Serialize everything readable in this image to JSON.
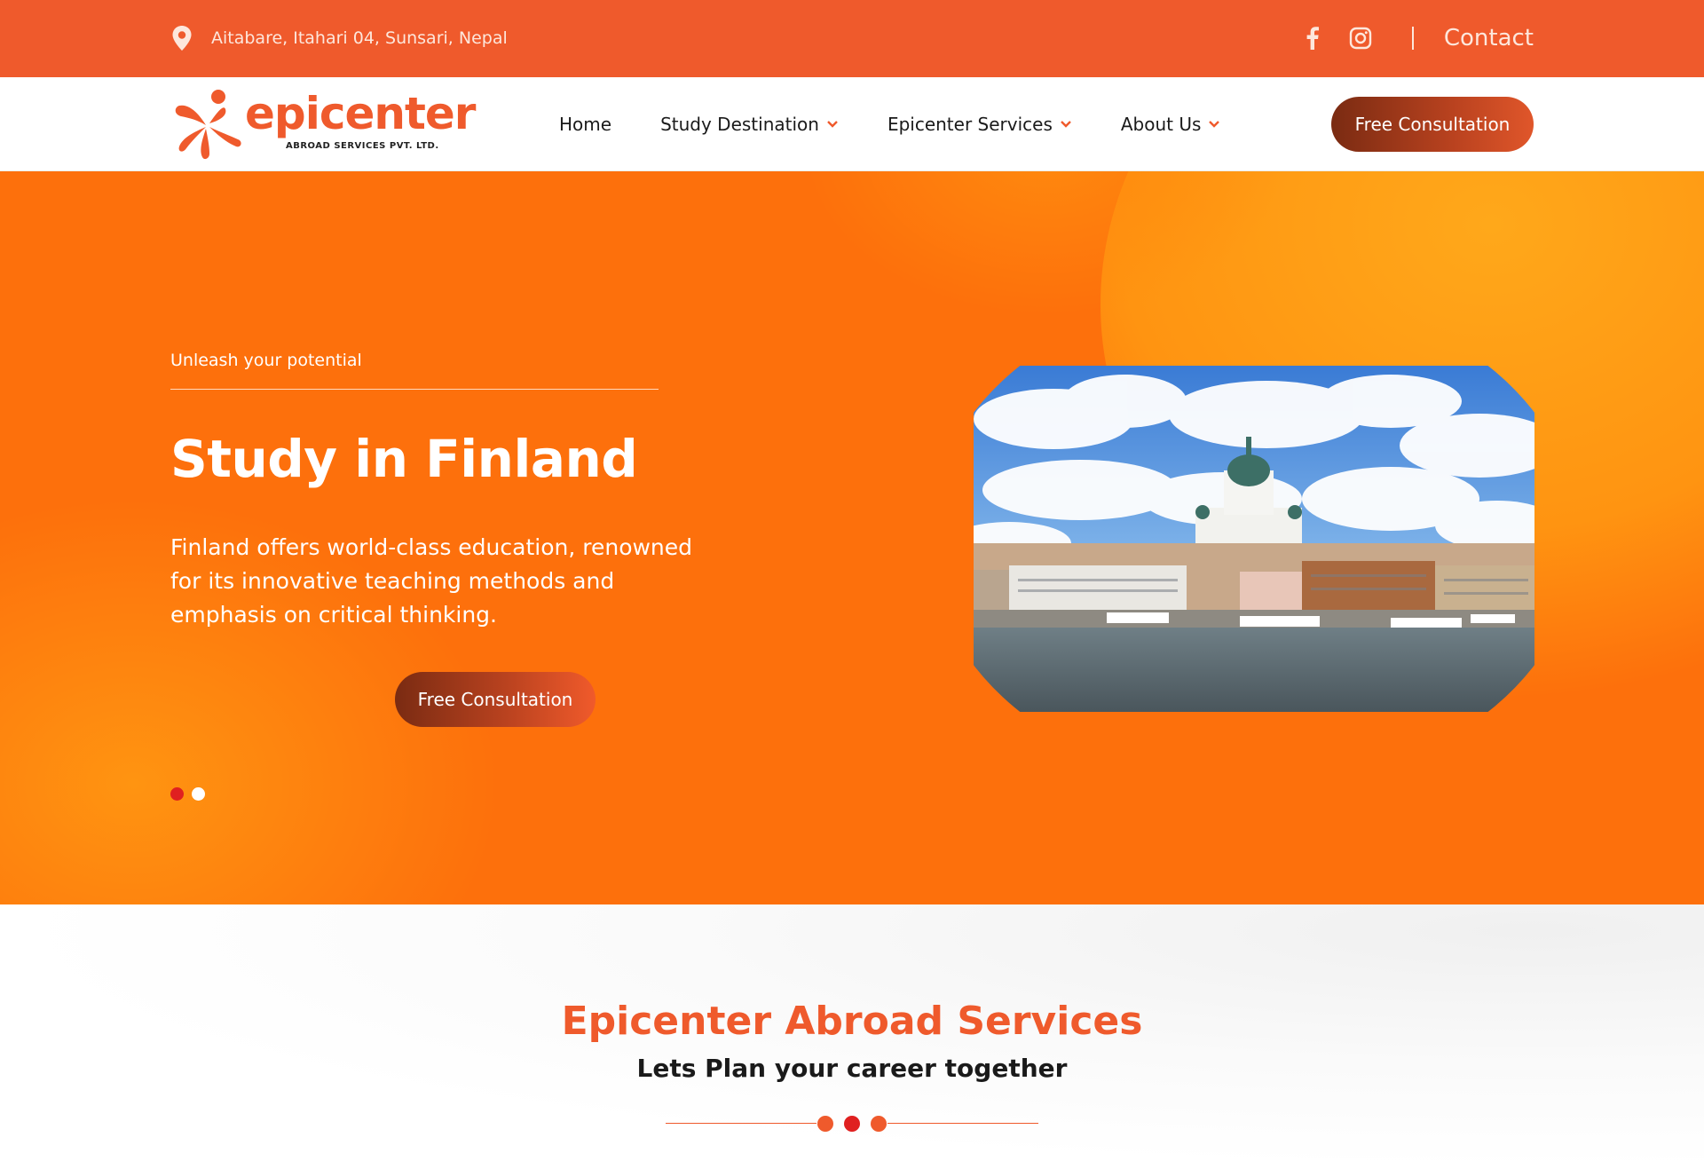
{
  "topbar": {
    "address": "Aitabare, Itahari 04, Sunsari, Nepal",
    "icons": [
      "location-pin-icon",
      "facebook-icon",
      "instagram-icon"
    ],
    "contact_label": "Contact"
  },
  "header": {
    "logo_word": "epicenter",
    "logo_tagline": "ABROAD SERVICES PVT. LTD.",
    "nav": [
      {
        "label": "Home",
        "dropdown": false
      },
      {
        "label": "Study Destination",
        "dropdown": true
      },
      {
        "label": "Epicenter Services",
        "dropdown": true
      },
      {
        "label": "About Us",
        "dropdown": true
      }
    ],
    "cta_label": "Free Consultation"
  },
  "hero": {
    "eyebrow": "Unleash your potential",
    "title": "Study in Finland",
    "description": "Finland offers world-class education, renowned for its innovative teaching methods and emphasis on critical thinking.",
    "cta_label": "Free Consultation",
    "slides_total": 2,
    "active_slide": 1
  },
  "intro": {
    "heading": "Epicenter Abroad Services",
    "subheading": "Lets Plan your career together"
  },
  "colors": {
    "brand_orange": "#ef5a2c",
    "hero_orange": "#fd700c",
    "cta_dark": "#7a2b12",
    "dot_active": "#e02020"
  }
}
